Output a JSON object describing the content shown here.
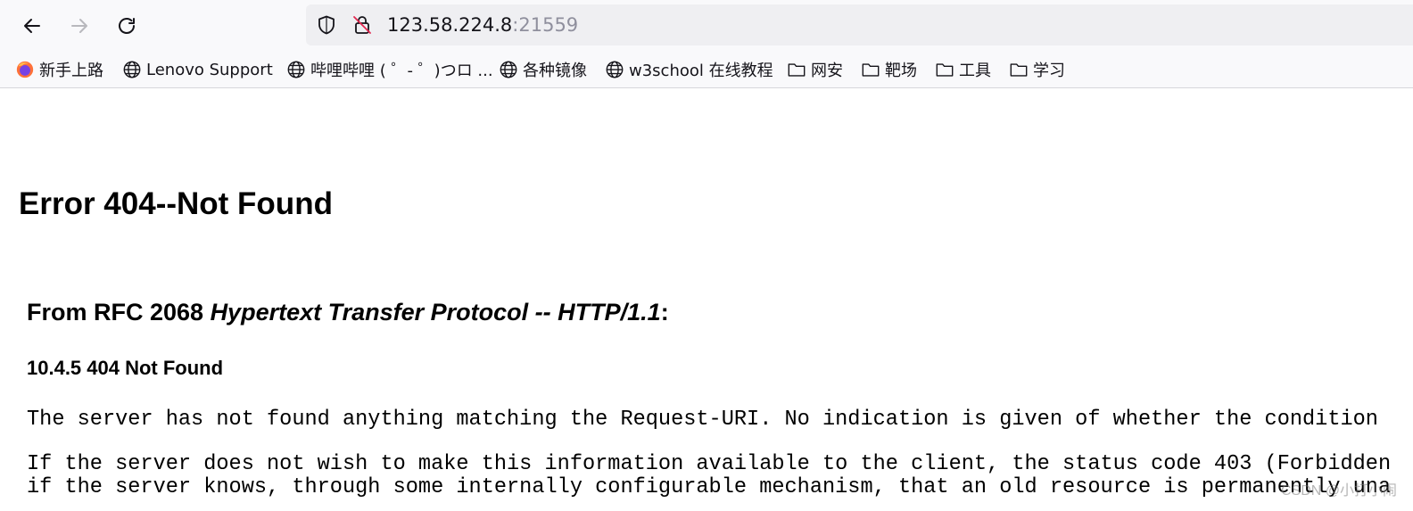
{
  "browser": {
    "nav": {
      "back_icon": "arrow-left-icon",
      "forward_icon": "arrow-right-icon",
      "reload_icon": "reload-icon"
    },
    "address": {
      "host": "123.58.224.8",
      "port": ":21559"
    },
    "bookmarks": [
      {
        "label": "新手上路",
        "icon": "firefox-icon"
      },
      {
        "label": "Lenovo Support",
        "icon": "globe-icon"
      },
      {
        "label": "哔哩哔哩 ( ゜- ゜)つロ ...",
        "icon": "globe-icon"
      },
      {
        "label": "各种镜像",
        "icon": "globe-icon"
      },
      {
        "label": "w3school 在线教程",
        "icon": "globe-icon"
      },
      {
        "label": "网安",
        "icon": "folder-icon"
      },
      {
        "label": "靶场",
        "icon": "folder-icon"
      },
      {
        "label": "工具",
        "icon": "folder-icon"
      },
      {
        "label": "学习",
        "icon": "folder-icon"
      }
    ]
  },
  "page": {
    "title": "Error 404--Not Found",
    "rfc_prefix": "From RFC 2068 ",
    "rfc_title": "Hypertext Transfer Protocol -- HTTP/1.1",
    "rfc_suffix": ":",
    "section": "10.4.5 404 Not Found",
    "paragraph1": "The server has not found anything matching the Request-URI. No indication is given of whether the condition",
    "paragraph2_line1": "If the server does not wish to make this information available to the client, the status code 403 (Forbidden",
    "paragraph2_line2": "if the server knows, through some internally configurable mechanism, that an old resource is permanently una",
    "watermark": "CSDN @小打小闹"
  },
  "colors": {
    "chrome_bg": "#f9f9fb",
    "urlbar_bg": "#efeff2",
    "text": "#15141a",
    "port_text": "#8f8f9d"
  }
}
